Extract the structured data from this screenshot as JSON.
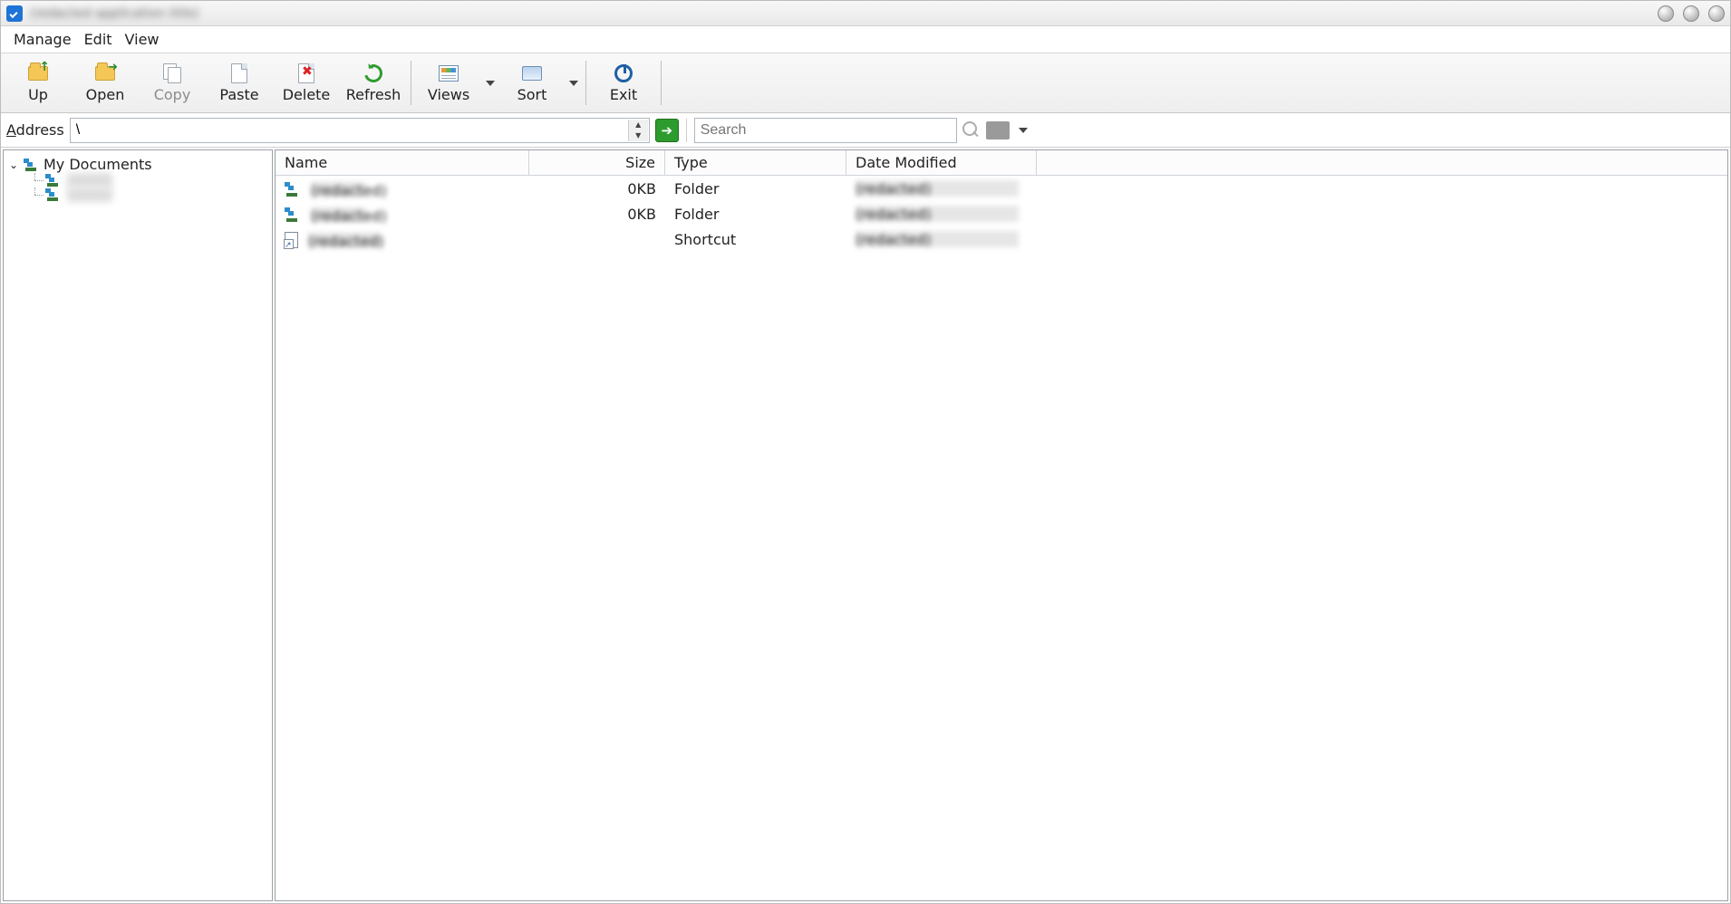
{
  "titlebar": {
    "title": "(redacted application title)"
  },
  "menu": {
    "items": [
      "Manage",
      "Edit",
      "View"
    ]
  },
  "toolbar": {
    "up": "Up",
    "open": "Open",
    "copy": "Copy",
    "paste": "Paste",
    "delete": "Delete",
    "refresh": "Refresh",
    "views": "Views",
    "sort": "Sort",
    "exit": "Exit"
  },
  "address": {
    "label": "Address",
    "value": "\\",
    "go_tooltip": "Go"
  },
  "search": {
    "placeholder": "Search"
  },
  "tree": {
    "root": "My Documents",
    "children": [
      {
        "name": "(redacted)"
      },
      {
        "name": "(redacted)"
      }
    ]
  },
  "list": {
    "columns": {
      "name": "Name",
      "size": "Size",
      "type": "Type",
      "date": "Date Modified"
    },
    "rows": [
      {
        "icon": "folder",
        "name": "(redacted)",
        "size": "0KB",
        "type": "Folder",
        "date": "(redacted)"
      },
      {
        "icon": "folder",
        "name": "(redacted)",
        "size": "0KB",
        "type": "Folder",
        "date": "(redacted)"
      },
      {
        "icon": "shortcut",
        "name": "(redacted)",
        "size": "",
        "type": "Shortcut",
        "date": "(redacted)"
      }
    ]
  }
}
